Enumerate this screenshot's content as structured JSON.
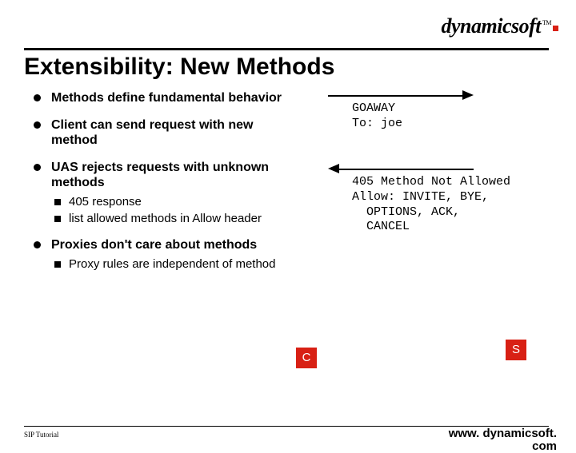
{
  "logo": {
    "text": "dynamicsoft",
    "tm": "TM"
  },
  "title": "Extensibility: New Methods",
  "bullets": [
    {
      "text": "Methods define fundamental behavior"
    },
    {
      "text": "Client can send request with new method"
    },
    {
      "text": "UAS rejects requests with unknown methods",
      "sub": [
        "405 response",
        "list allowed methods in Allow header"
      ]
    },
    {
      "text": "Proxies don't care about methods",
      "sub": [
        "Proxy rules are independent of method"
      ]
    }
  ],
  "diagram": {
    "request": {
      "line1": "GOAWAY",
      "line2": "To: joe"
    },
    "response": {
      "line1": "405 Method Not Allowed",
      "line2": "Allow: INVITE, BYE,",
      "line3": "  OPTIONS, ACK,",
      "line4": "  CANCEL"
    },
    "client_label": "C",
    "server_label": "S"
  },
  "footer": {
    "left": "SIP Tutorial",
    "right_line1": "www. dynamicsoft.",
    "right_line2": "com"
  }
}
